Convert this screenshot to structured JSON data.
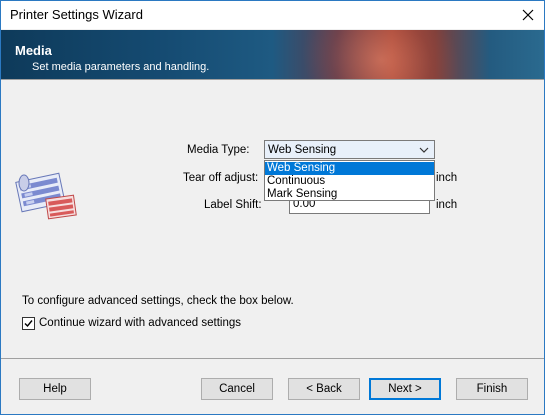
{
  "window": {
    "title": "Printer Settings Wizard"
  },
  "banner": {
    "title": "Media",
    "subtitle": "Set media parameters and handling."
  },
  "form": {
    "media_type_label": "Media Type:",
    "media_type_value": "Web Sensing",
    "media_type_options": [
      "Web Sensing",
      "Continuous",
      "Mark Sensing"
    ],
    "tear_off_label": "Tear off adjust:",
    "tear_off_unit": "inch",
    "label_shift_label": "Label Shift:",
    "label_shift_value": "0.00",
    "label_shift_unit": "inch"
  },
  "advanced": {
    "hint": "To configure advanced settings, check the box below.",
    "checkbox_label": "Continue wizard with advanced settings",
    "checked": true
  },
  "buttons": {
    "help": "Help",
    "cancel": "Cancel",
    "back": "< Back",
    "next": "Next >",
    "finish": "Finish"
  },
  "icons": {
    "close": "close-icon",
    "dropdown": "chevron-down-icon",
    "media": "label-roll-icon",
    "check": "checkmark-icon"
  }
}
